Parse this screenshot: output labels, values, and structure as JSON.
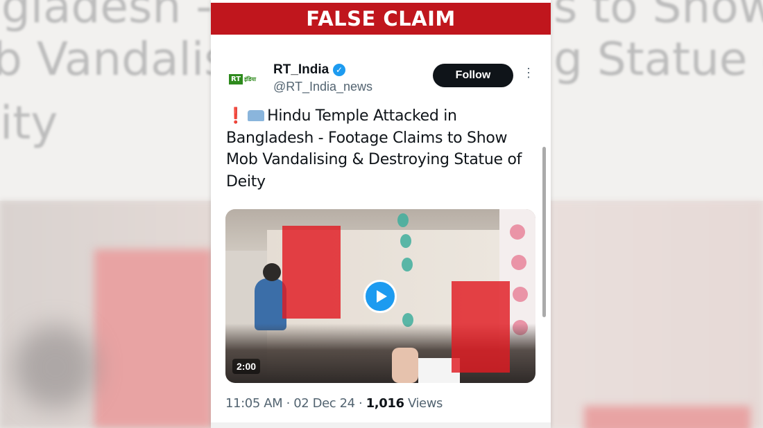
{
  "banner": {
    "label": "FALSE CLAIM"
  },
  "background": {
    "line1": "ngladesh -",
    "line2": "b Vandalis",
    "line3": "ity",
    "line4": "s to Show",
    "line5": "g Statue o"
  },
  "tweet": {
    "avatar_logo": "RT",
    "avatar_sub": "इंडिया",
    "display_name": "RT_India",
    "handle": "@RT_India_news",
    "follow_label": "Follow",
    "text": "Hindu Temple Attacked in Bangladesh - Footage Claims to Show Mob Vandalising & Destroying Statue of Deity",
    "icons": [
      "exclamation-icon",
      "telephone-icon"
    ],
    "video": {
      "duration": "2:00"
    },
    "time": "11:05 AM",
    "date": "02 Dec 24",
    "views_count": "1,016",
    "views_label": "Views"
  },
  "colors": {
    "banner": "#c0161d",
    "follow": "#0f1419",
    "accent": "#1d9bf0",
    "redaction": "#e11b22"
  }
}
